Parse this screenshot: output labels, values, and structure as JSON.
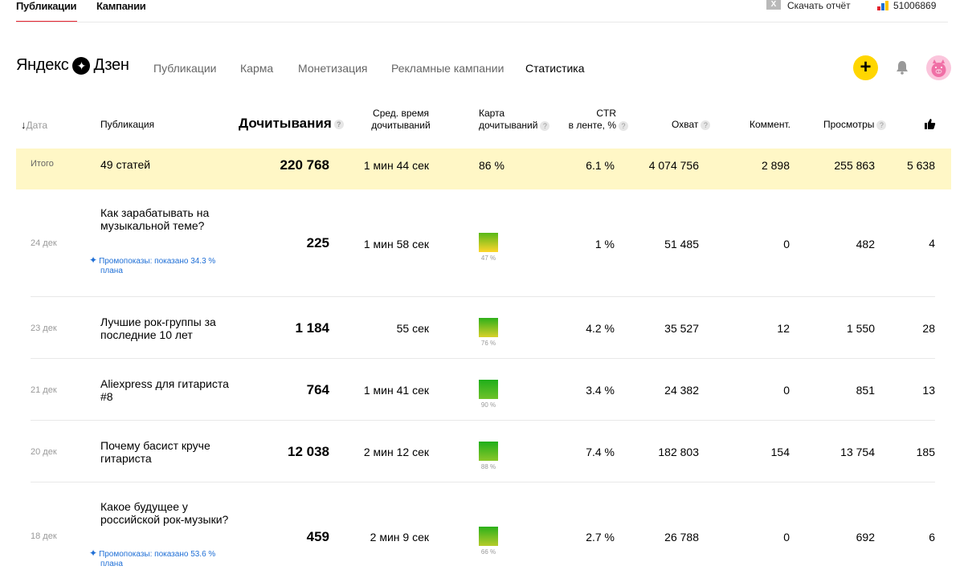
{
  "top_bar": {
    "tabs": [
      {
        "label": "Публикации"
      },
      {
        "label": "Кампании"
      }
    ],
    "download_label": "Скачать отчёт",
    "metrika_label": "51006869"
  },
  "header": {
    "logo_text_left": "Яндекс",
    "logo_text_right": "Дзен",
    "nav": [
      {
        "label": "Публикации"
      },
      {
        "label": "Карма"
      },
      {
        "label": "Монетизация"
      },
      {
        "label": "Рекламные кампании"
      },
      {
        "label": "Статистика"
      }
    ],
    "create_label": "+"
  },
  "table": {
    "headers": {
      "date": "Дата",
      "publication": "Публикация",
      "dochityvaniya": "Дочитывания",
      "avg_time_1": "Сред. время",
      "avg_time_2": "дочитываний",
      "map_1": "Карта",
      "map_2": "дочитываний",
      "ctr_1": "CTR",
      "ctr_2": "в ленте, %",
      "reach": "Охват",
      "comments": "Коммент.",
      "views": "Просмотры",
      "qm": "?"
    },
    "total": {
      "label": "Итого",
      "publication": "49 статей",
      "dochityvaniya": "220 768",
      "avg_time": "1 мин 44 сек",
      "map": "86 %",
      "ctr": "6.1 %",
      "reach": "4 074 756",
      "comments": "2 898",
      "views": "255 863",
      "likes": "5 638"
    },
    "rows": [
      {
        "date": "24 дек",
        "title_1": "Как зарабатывать на",
        "title_2": "музыкальной теме?",
        "promo_1": "Промопоказы: показано 34.3 %",
        "promo_2": "плана",
        "dochityvaniya": "225",
        "avg_time": "1 мин 58 сек",
        "map_pct": "47 %",
        "ctr": "1 %",
        "reach": "51 485",
        "comments": "0",
        "views": "482",
        "likes": "4"
      },
      {
        "date": "23 дек",
        "title_1": "Лучшие рок-группы за",
        "title_2": "последние 10 лет",
        "dochityvaniya": "1 184",
        "avg_time": "55 сек",
        "map_pct": "76 %",
        "ctr": "4.2 %",
        "reach": "35 527",
        "comments": "12",
        "views": "1 550",
        "likes": "28"
      },
      {
        "date": "21 дек",
        "title_1": "Aliexpress для гитариста",
        "title_2": "#8",
        "dochityvaniya": "764",
        "avg_time": "1 мин 41 сек",
        "map_pct": "90 %",
        "ctr": "3.4 %",
        "reach": "24 382",
        "comments": "0",
        "views": "851",
        "likes": "13"
      },
      {
        "date": "20 дек",
        "title_1": "Почему басист круче",
        "title_2": "гитариста",
        "dochityvaniya": "12 038",
        "avg_time": "2 мин 12 сек",
        "map_pct": "88 %",
        "ctr": "7.4 %",
        "reach": "182 803",
        "comments": "154",
        "views": "13 754",
        "likes": "185"
      },
      {
        "date": "18 дек",
        "title_1": "Какое будущее у",
        "title_2": "российской рок-музыки?",
        "promo_1": "Промопоказы: показано 53.6 %",
        "promo_2": "плана",
        "dochityvaniya": "459",
        "avg_time": "2 мин 9 сек",
        "map_pct": "66 %",
        "ctr": "2.7 %",
        "reach": "26 788",
        "comments": "0",
        "views": "692",
        "likes": "6"
      }
    ]
  },
  "colors": {
    "accent_red": "#e4222d",
    "yellow_button": "#ffd600",
    "total_band": "#fff7c6",
    "promo_link": "#1f6fd6"
  }
}
